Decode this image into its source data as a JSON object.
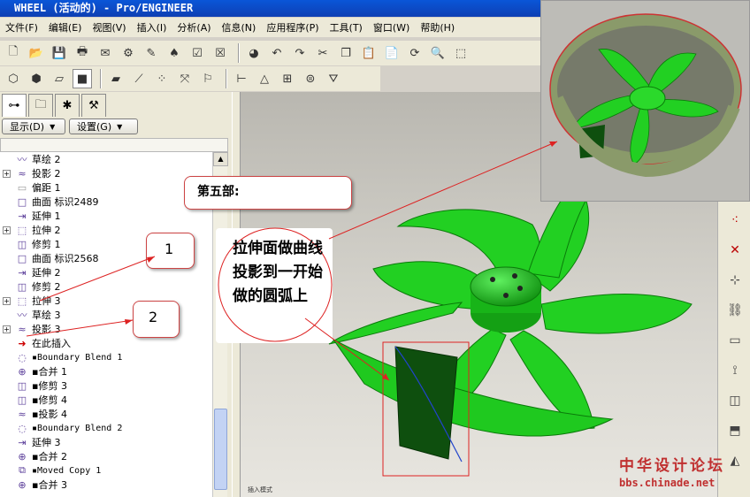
{
  "window": {
    "title": "WHEEL (活动的) - Pro/ENGINEER"
  },
  "menu": [
    "文件(F)",
    "编辑(E)",
    "视图(V)",
    "插入(I)",
    "分析(A)",
    "信息(N)",
    "应用程序(P)",
    "工具(T)",
    "窗口(W)",
    "帮助(H)"
  ],
  "nav": {
    "show_label": "显示(D)",
    "settings_label": "设置(G)"
  },
  "tree": [
    {
      "label": "草绘 2",
      "icon": "sketch-icon",
      "expand": false
    },
    {
      "label": "投影 2",
      "icon": "projection-icon",
      "expand": true
    },
    {
      "label": "偏距 1",
      "icon": "offset-icon",
      "expand": false
    },
    {
      "label": "曲面 标识2489",
      "icon": "surface-icon",
      "expand": false
    },
    {
      "label": "延伸 1",
      "icon": "extend-icon",
      "expand": false
    },
    {
      "label": "拉伸 2",
      "icon": "extrude-icon",
      "expand": true
    },
    {
      "label": "修剪 1",
      "icon": "trim-icon",
      "expand": false
    },
    {
      "label": "曲面 标识2568",
      "icon": "surface-icon",
      "expand": false
    },
    {
      "label": "延伸 2",
      "icon": "extend-icon",
      "expand": false
    },
    {
      "label": "修剪 2",
      "icon": "trim-icon",
      "expand": false
    },
    {
      "label": "拉伸 3",
      "icon": "extrude-icon",
      "expand": true
    },
    {
      "label": "草绘 3",
      "icon": "sketch-icon",
      "expand": false
    },
    {
      "label": "投影 3",
      "icon": "projection-icon",
      "expand": true
    },
    {
      "label": "在此插入",
      "icon": "insert-here-icon",
      "expand": false
    },
    {
      "label": "▪Boundary Blend 1",
      "icon": "blend-icon",
      "expand": false
    },
    {
      "label": "▪合并 1",
      "icon": "merge-icon",
      "expand": false
    },
    {
      "label": "▪修剪 3",
      "icon": "trim-icon",
      "expand": false
    },
    {
      "label": "▪修剪 4",
      "icon": "trim-icon",
      "expand": false
    },
    {
      "label": "▪投影 4",
      "icon": "projection-icon",
      "expand": false
    },
    {
      "label": "▪Boundary Blend 2",
      "icon": "blend-icon",
      "expand": false
    },
    {
      "label": "延伸 3",
      "icon": "extend-icon",
      "expand": false
    },
    {
      "label": "▪合并 2",
      "icon": "merge-icon",
      "expand": false
    },
    {
      "label": "▪Moved Copy 1",
      "icon": "copy-icon",
      "expand": false
    },
    {
      "label": "▪合并 3",
      "icon": "merge-icon",
      "expand": false
    }
  ],
  "callouts": {
    "title": "第五部:",
    "num1": "1",
    "num2": "2",
    "description": "拉伸面做曲线投影到一开始做的圆弧上"
  },
  "viewport": {
    "small_label": "插入模式"
  },
  "watermark": {
    "line1": "中华设计论坛",
    "line2": "bbs.chinade.net"
  },
  "colors": {
    "blade": "#22d022",
    "blade_dark": "#139b13",
    "callout_border": "#cc3333",
    "annotation_red": "#dd2222"
  }
}
